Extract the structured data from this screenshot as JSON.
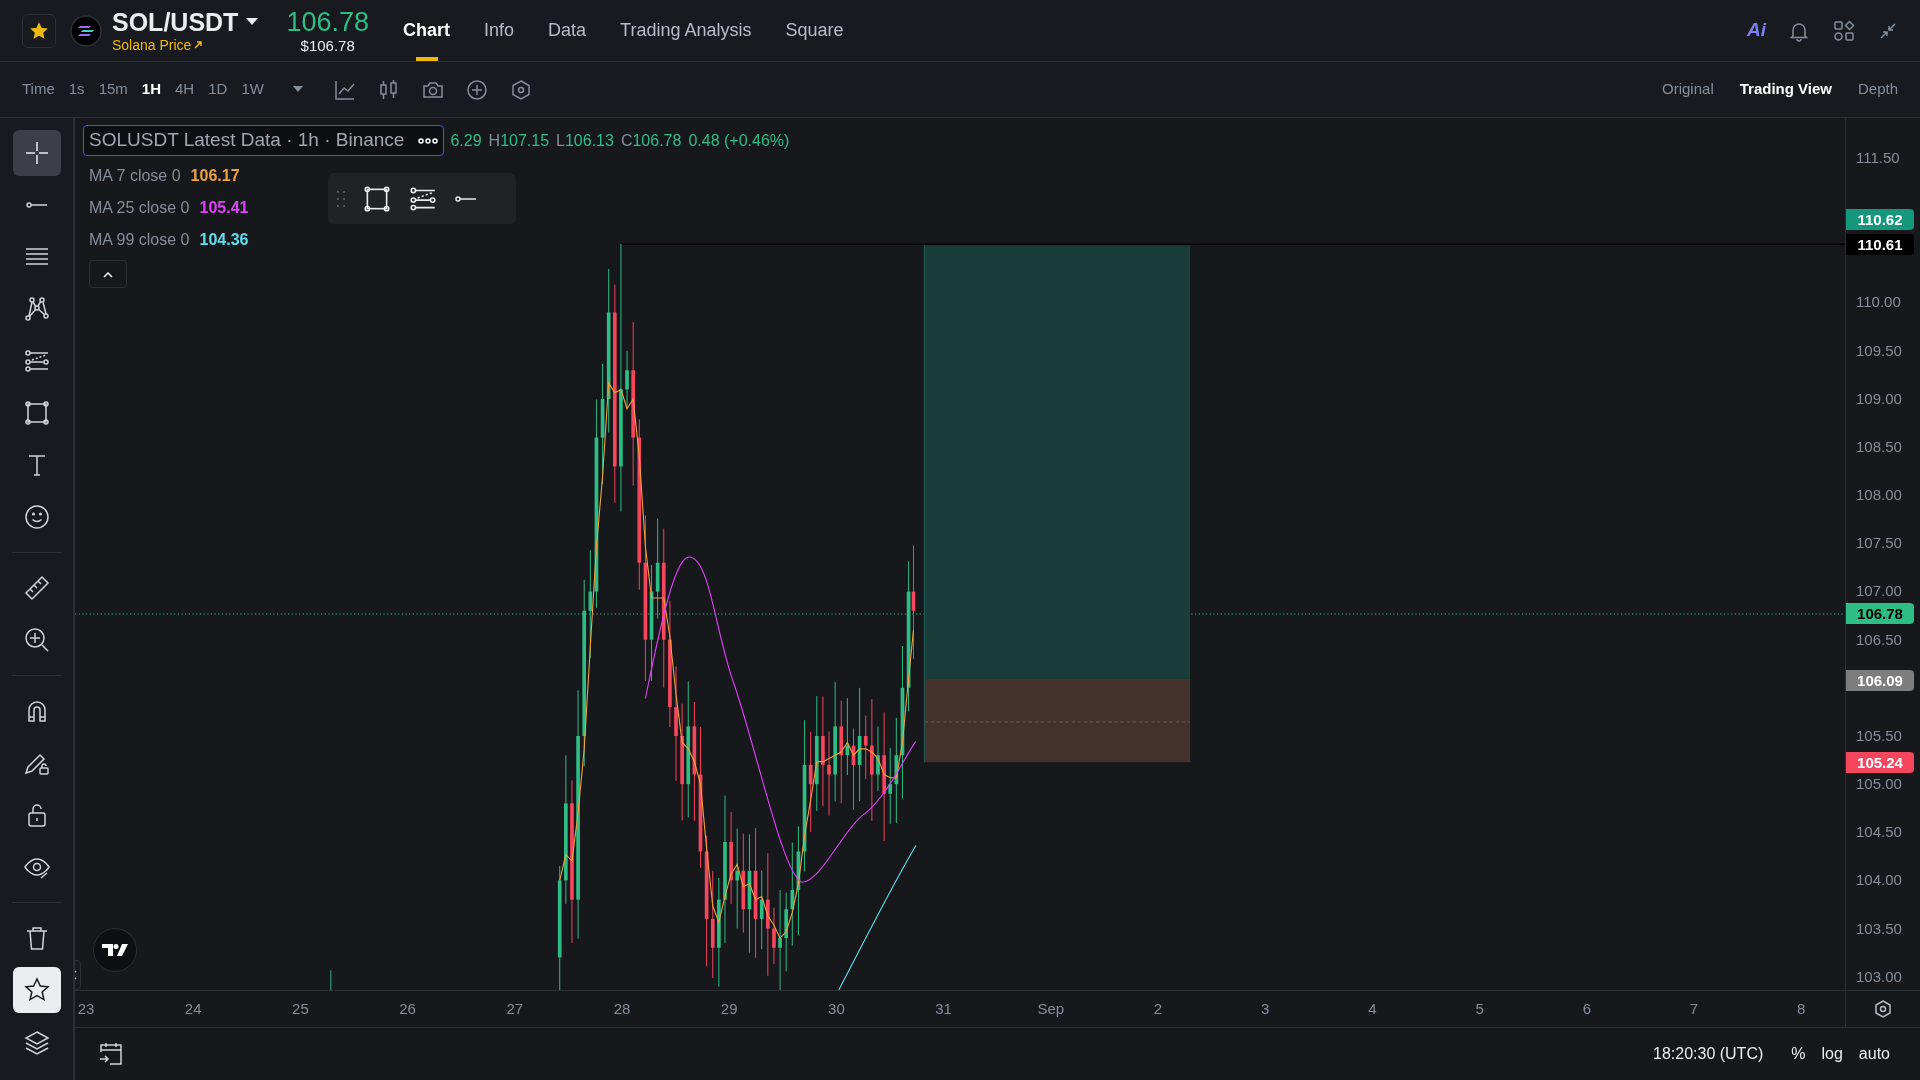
{
  "header": {
    "favorite": true,
    "symbol": "SOL/USDT",
    "subtitle": "Solana Price",
    "price": "106.78",
    "price_usd": "$106.78",
    "ai_label": "Ai",
    "tabs": [
      {
        "label": "Chart",
        "selected": true
      },
      {
        "label": "Info",
        "selected": false
      },
      {
        "label": "Data",
        "selected": false
      },
      {
        "label": "Trading Analysis",
        "selected": false
      },
      {
        "label": "Square",
        "selected": false
      }
    ]
  },
  "toolbar": {
    "time_label": "Time",
    "intervals": [
      {
        "label": "1s",
        "selected": false
      },
      {
        "label": "15m",
        "selected": false
      },
      {
        "label": "1H",
        "selected": true
      },
      {
        "label": "4H",
        "selected": false
      },
      {
        "label": "1D",
        "selected": false
      },
      {
        "label": "1W",
        "selected": false
      }
    ],
    "views": [
      {
        "label": "Original",
        "selected": false
      },
      {
        "label": "Trading View",
        "selected": true
      },
      {
        "label": "Depth",
        "selected": false
      }
    ]
  },
  "left_toolbar": {
    "groups": [
      {
        "tools": [
          {
            "kind": "crosshair",
            "selected": true
          },
          {
            "kind": "line",
            "selected": false
          },
          {
            "kind": "parallel",
            "selected": false
          },
          {
            "kind": "pattern",
            "selected": false
          },
          {
            "kind": "fib",
            "selected": false
          },
          {
            "kind": "rect",
            "selected": false
          },
          {
            "kind": "text",
            "selected": false
          },
          {
            "kind": "emoji",
            "selected": false
          }
        ]
      },
      {
        "tools": [
          {
            "kind": "ruler",
            "selected": false
          },
          {
            "kind": "zoom",
            "selected": false
          }
        ]
      },
      {
        "tools": [
          {
            "kind": "magnet",
            "selected": false
          },
          {
            "kind": "pencil",
            "selected": false
          },
          {
            "kind": "lock",
            "selected": false
          },
          {
            "kind": "eye",
            "selected": false
          }
        ]
      },
      {
        "tools": [
          {
            "kind": "trash",
            "selected": false
          },
          {
            "kind": "star",
            "selected": true
          },
          {
            "kind": "layers",
            "selected": false
          }
        ]
      }
    ]
  },
  "legend": {
    "title": "SOLUSDT Latest Data · 1h · Binance",
    "ohlc": [
      {
        "value": "6.29"
      },
      {
        "key": "H",
        "value": "107.15"
      },
      {
        "key": "L",
        "value": "106.13"
      },
      {
        "key": "C",
        "value": "106.78"
      }
    ],
    "change": "0.48 (+0.46%)",
    "indicators": [
      {
        "label": "MA 7 close 0",
        "value": "106.17",
        "color": "#f0a23b"
      },
      {
        "label": "MA 25 close 0",
        "value": "105.41",
        "color": "#e040fb"
      },
      {
        "label": "MA 99 close 0",
        "value": "104.36",
        "color": "#5ce0f0"
      }
    ]
  },
  "price_axis": {
    "ticks": [
      "111.50",
      "110.00",
      "109.50",
      "109.00",
      "108.50",
      "108.00",
      "107.50",
      "107.00",
      "106.50",
      "105.50",
      "105.00",
      "104.50",
      "104.00",
      "103.50",
      "103.00"
    ],
    "tags": [
      {
        "text": "110.62",
        "color": "#14977b"
      },
      {
        "text": "110.61",
        "color": "#000000"
      },
      {
        "text": "106.78",
        "color": "#2ebd85"
      },
      {
        "text": "106.09",
        "color": "#7d7d7d"
      },
      {
        "text": "105.24",
        "color": "#f6465d"
      }
    ]
  },
  "time_axis": {
    "labels": [
      "23",
      "24",
      "25",
      "26",
      "27",
      "28",
      "29",
      "30",
      "31",
      "Sep",
      "2",
      "3",
      "4",
      "5",
      "6",
      "7",
      "8"
    ]
  },
  "status_bar": {
    "time": "18:20:30 (UTC)",
    "options": [
      "%",
      "log",
      "auto"
    ]
  }
}
